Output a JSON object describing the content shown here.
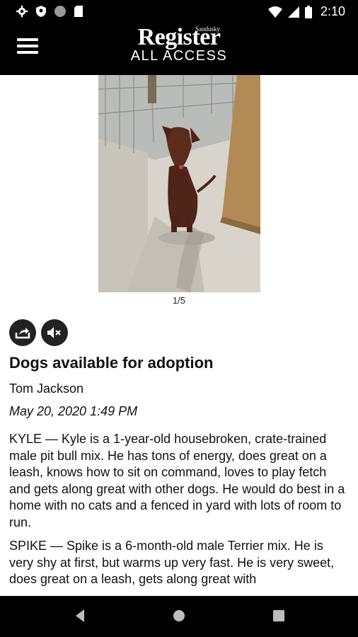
{
  "status_bar": {
    "time": "2:10"
  },
  "header": {
    "logo_small": "Sandusky",
    "logo_brand": "Register",
    "logo_sub": "ALL ACCESS"
  },
  "gallery": {
    "counter": "1/5"
  },
  "article": {
    "title": "Dogs available for adoption",
    "author": "Tom Jackson",
    "date": "May 20, 2020 1:49 PM",
    "paragraphs": [
      "KYLE — Kyle is a 1-year-old housebroken, crate-trained male pit bull mix. He has tons of energy, does great on a leash, knows how to sit on command, loves to play fetch and gets along great with other dogs. He would do best in a home with no cats and a fenced in yard with lots of room to run.",
      "SPIKE — Spike is a 6-month-old male Terrier mix. He is very shy at first, but warms up very fast. He is very sweet, does great on a leash, gets along great with"
    ]
  },
  "icons": {
    "share": "share-icon",
    "mute": "mute-icon",
    "menu": "hamburger-menu-icon"
  }
}
